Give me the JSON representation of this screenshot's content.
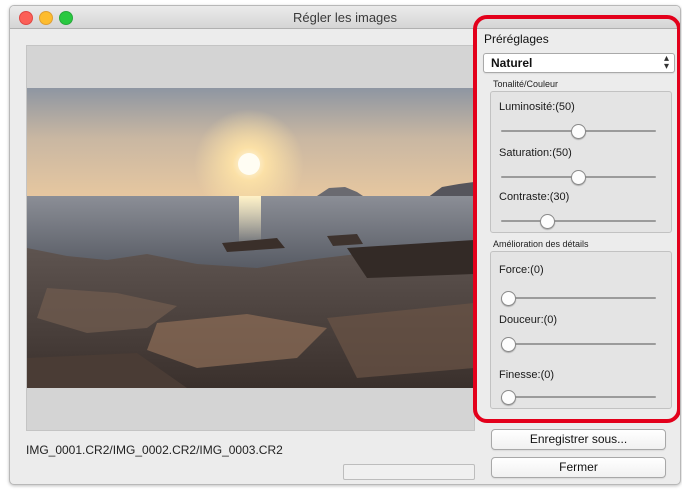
{
  "window": {
    "title": "Régler les images",
    "filename_line": "IMG_0001.CR2/IMG_0002.CR2/IMG_0003.CR2",
    "progress": 0
  },
  "presets": {
    "label": "Préréglages",
    "selected": "Naturel"
  },
  "tone": {
    "label": "Tonalité/Couleur",
    "sliders": [
      {
        "label": "Luminosité:(50)",
        "value": 50
      },
      {
        "label": "Saturation:(50)",
        "value": 50
      },
      {
        "label": "Contraste:(30)",
        "value": 30
      }
    ]
  },
  "detail": {
    "label": "Amélioration des détails",
    "sliders": [
      {
        "label": "Force:(0)",
        "value": 0
      },
      {
        "label": "Douceur:(0)",
        "value": 0
      },
      {
        "label": "Finesse:(0)",
        "value": 0
      }
    ]
  },
  "buttons": {
    "save_as": "Enregistrer sous...",
    "close": "Fermer"
  },
  "colors": {
    "highlight_frame": "#e3001b",
    "traffic_close": "#fc5f57",
    "traffic_minimize": "#fdbc2e",
    "traffic_maximize": "#29c940"
  }
}
